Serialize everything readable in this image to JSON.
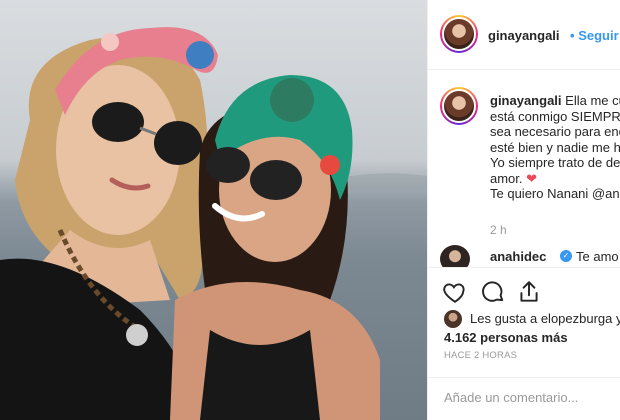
{
  "header": {
    "username": "ginayangali",
    "separator": "•",
    "follow_label": "Seguir",
    "avatar_icon": "profile-avatar"
  },
  "caption": {
    "username": "ginayangali",
    "lines": [
      "Ella me cu",
      "está conmigo SIEMPRE",
      "sea necesario para enc",
      "esté bien y nadie me h",
      "Yo siempre trato de de",
      "amor.",
      "Te quiero Nanani @ana"
    ],
    "heart": "❤",
    "time": "2 h"
  },
  "reply": {
    "username": "anahidec",
    "verified_mark": "✓",
    "text": "Te amo"
  },
  "actions": {
    "icons": [
      "heart-icon",
      "comment-icon",
      "share-icon"
    ]
  },
  "likes": {
    "line1": "Les gusta a elopezburga y",
    "line2": "4.162 personas más"
  },
  "timestamp": "HACE 2 HORAS",
  "comment_box": {
    "placeholder": "Añade un comentario..."
  },
  "colors": {
    "accent": "#3897f0",
    "heart": "#ed4956",
    "muted": "#999999",
    "headwrap_left": "#e77f8f",
    "headwrap_right": "#1f9a7d"
  }
}
